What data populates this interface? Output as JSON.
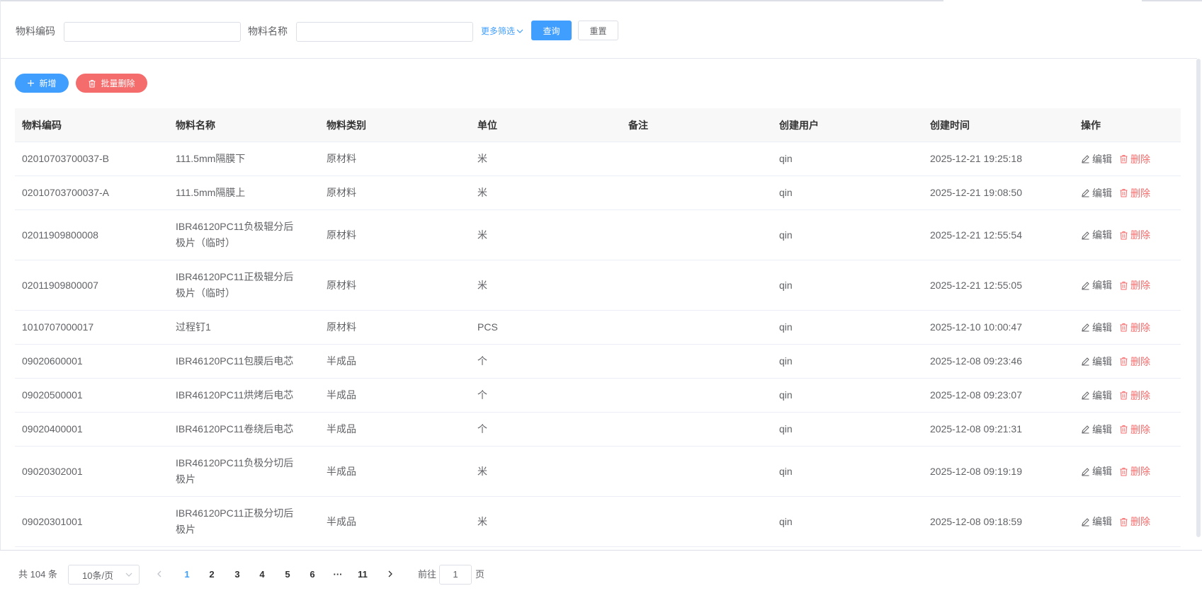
{
  "filters": {
    "code_label": "物料编码",
    "code_value": "",
    "name_label": "物料名称",
    "name_value": "",
    "more_label": "更多筛选",
    "query_label": "查询",
    "reset_label": "重置"
  },
  "toolbar": {
    "add_label": "新增",
    "batch_delete_label": "批量删除"
  },
  "table": {
    "headers": [
      "物料编码",
      "物料名称",
      "物料类别",
      "单位",
      "备注",
      "创建用户",
      "创建时间",
      "操作"
    ],
    "rows": [
      {
        "code": "02010703700037-B",
        "name": "111.5mm隔膜下",
        "category": "原材料",
        "unit": "米",
        "remark": "",
        "user": "qin",
        "time": "2025-12-21 19:25:18"
      },
      {
        "code": "02010703700037-A",
        "name": "111.5mm隔膜上",
        "category": "原材料",
        "unit": "米",
        "remark": "",
        "user": "qin",
        "time": "2025-12-21 19:08:50"
      },
      {
        "code": "02011909800008",
        "name": "IBR46120PC11负极辊分后极片（临时）",
        "category": "原材料",
        "unit": "米",
        "remark": "",
        "user": "qin",
        "time": "2025-12-21 12:55:54"
      },
      {
        "code": "02011909800007",
        "name": "IBR46120PC11正极辊分后极片（临时）",
        "category": "原材料",
        "unit": "米",
        "remark": "",
        "user": "qin",
        "time": "2025-12-21 12:55:05"
      },
      {
        "code": "1010707000017",
        "name": "过程钉1",
        "category": "原材料",
        "unit": "PCS",
        "remark": "",
        "user": "qin",
        "time": "2025-12-10 10:00:47"
      },
      {
        "code": "09020600001",
        "name": "IBR46120PC11包膜后电芯",
        "category": "半成品",
        "unit": "个",
        "remark": "",
        "user": "qin",
        "time": "2025-12-08 09:23:46"
      },
      {
        "code": "09020500001",
        "name": "IBR46120PC11烘烤后电芯",
        "category": "半成品",
        "unit": "个",
        "remark": "",
        "user": "qin",
        "time": "2025-12-08 09:23:07"
      },
      {
        "code": "09020400001",
        "name": "IBR46120PC11卷绕后电芯",
        "category": "半成品",
        "unit": "个",
        "remark": "",
        "user": "qin",
        "time": "2025-12-08 09:21:31"
      },
      {
        "code": "09020302001",
        "name": "IBR46120PC11负极分切后极片",
        "category": "半成品",
        "unit": "米",
        "remark": "",
        "user": "qin",
        "time": "2025-12-08 09:19:19"
      },
      {
        "code": "09020301001",
        "name": "IBR46120PC11正极分切后极片",
        "category": "半成品",
        "unit": "米",
        "remark": "",
        "user": "qin",
        "time": "2025-12-08 09:18:59"
      }
    ],
    "edit_label": "编辑",
    "delete_label": "删除"
  },
  "pagination": {
    "total_text": "共 104 条",
    "page_size": "10条/页",
    "pages": [
      "1",
      "2",
      "3",
      "4",
      "5",
      "6",
      "···",
      "11"
    ],
    "current_page": "1",
    "goto_label": "前往",
    "goto_value": "1",
    "goto_suffix": "页"
  },
  "colors": {
    "primary": "#409eff",
    "danger": "#f56c6c",
    "border": "#dcdfe6",
    "header_bg": "#f8f8f9"
  }
}
